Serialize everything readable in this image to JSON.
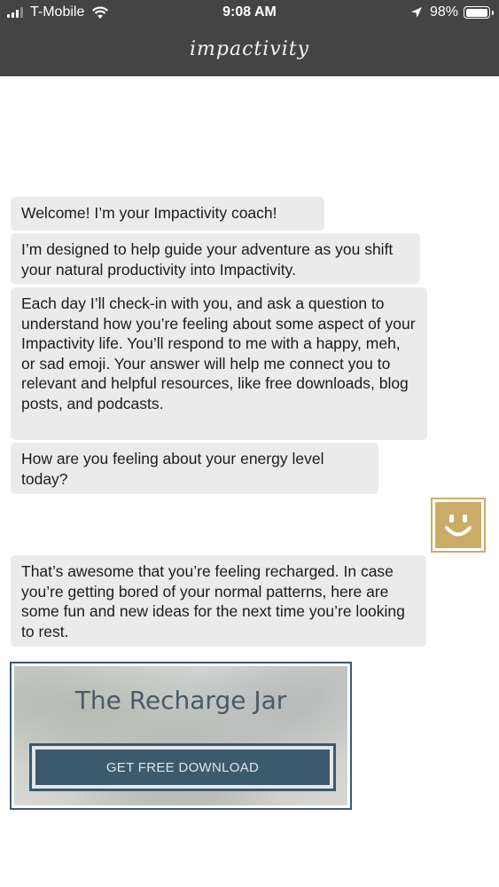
{
  "status_bar": {
    "carrier": "T-Mobile",
    "time": "9:08 AM",
    "battery": "98%",
    "battery_level": 0.98,
    "signal_bars": 3
  },
  "header": {
    "title": "impactivity"
  },
  "chat": {
    "messages": [
      "Welcome! I’m your Impactivity coach!",
      "I’m designed to help guide your adventure as you shift your natural productivity into Impactivity.",
      "Each day I’ll check-in with you, and ask a question to understand how you’re feeling about some aspect of your Impactivity life. You’ll respond to me with a happy, meh, or sad emoji. Your answer will help me connect you to relevant and helpful resources, like free downloads, blog posts, and podcasts.",
      "How are you feeling about your energy level today?",
      "That’s awesome that you’re feeling recharged. In case you’re getting bored of your normal patterns, here are some fun and new ideas for the next time you’re looking to rest."
    ],
    "user_response_icon": "happy-face-icon"
  },
  "card": {
    "title": "The Recharge Jar",
    "button_label": "GET FREE DOWNLOAD"
  },
  "colors": {
    "header_bg": "#444444",
    "bubble_bg": "#ebebeb",
    "accent_gold": "#c9ad67",
    "card_blue": "#3b5a6e"
  }
}
